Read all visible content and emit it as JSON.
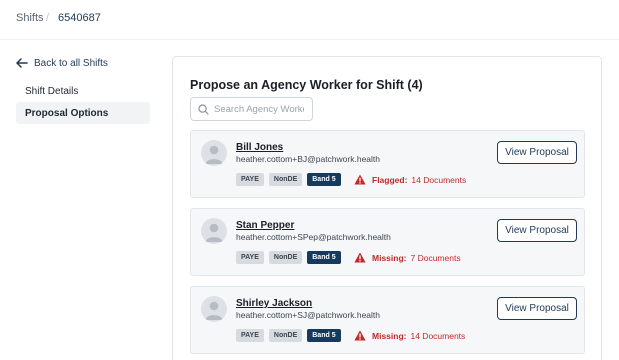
{
  "breadcrumb": {
    "root": "Shifts",
    "separator": "/",
    "current": "6540687"
  },
  "sidebar": {
    "back_label": "Back to all Shifts",
    "items": [
      {
        "label": "Shift Details",
        "active": false
      },
      {
        "label": "Proposal Options",
        "active": true
      }
    ]
  },
  "main": {
    "title": "Propose an Agency Worker for Shift (4)",
    "search": {
      "placeholder": "Search Agency Workers",
      "value": ""
    },
    "view_button_label": "View Proposal",
    "workers": [
      {
        "name": "Bill Jones",
        "email": "heather.cottom+BJ@patchwork.health",
        "tags": [
          "PAYE",
          "NonDE",
          "Band 5"
        ],
        "status_label": "Flagged:",
        "status_count": "14 Documents"
      },
      {
        "name": "Stan Pepper",
        "email": "heather.cottom+SPep@patchwork.health",
        "tags": [
          "PAYE",
          "NonDE",
          "Band 5"
        ],
        "status_label": "Missing:",
        "status_count": "7 Documents"
      },
      {
        "name": "Shirley Jackson",
        "email": "heather.cottom+SJ@patchwork.health",
        "tags": [
          "PAYE",
          "NonDE",
          "Band 5"
        ],
        "status_label": "Missing:",
        "status_count": "14 Documents"
      }
    ]
  },
  "colors": {
    "primary": "#1f3a55",
    "band_badge": "#163a5e",
    "warning": "#c02a2a",
    "card_bg": "#f6f7f9",
    "active_nav_bg": "#f1f3f5"
  },
  "icons": {
    "back": "arrow-left-icon",
    "search": "search-icon",
    "avatar": "user-avatar-icon",
    "warning": "warning-triangle-icon"
  }
}
